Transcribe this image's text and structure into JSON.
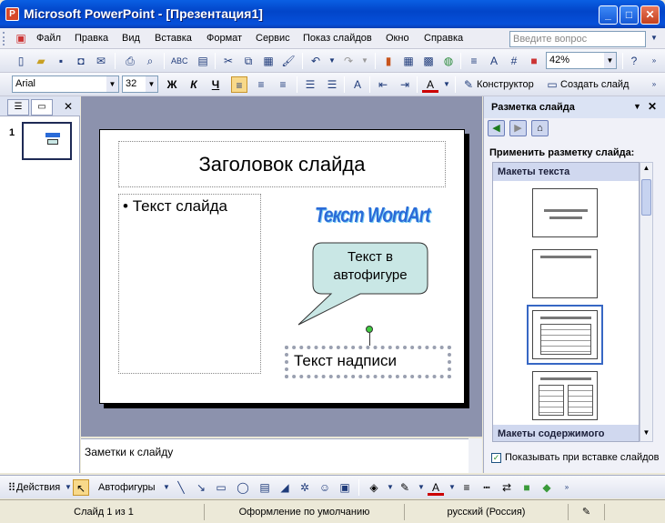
{
  "window": {
    "title": "Microsoft PowerPoint - [Презентация1]"
  },
  "menubar": {
    "items": [
      "Файл",
      "Правка",
      "Вид",
      "Вставка",
      "Формат",
      "Сервис",
      "Показ слайдов",
      "Окно",
      "Справка"
    ],
    "help_placeholder": "Введите вопрос"
  },
  "toolbar_standard": {
    "zoom": "42%"
  },
  "toolbar_format": {
    "font_name": "Arial",
    "font_size": "32",
    "bold": "Ж",
    "italic": "К",
    "underline": "Ч",
    "designer_label": "Конструктор",
    "new_slide_label": "Создать слайд"
  },
  "left_panel": {
    "slide_number": "1"
  },
  "slide": {
    "title": "Заголовок слайда",
    "bullet_text": "Текст слайда",
    "wordart_text": "Текст WordArt",
    "callout_text": "Текст в автофигуре",
    "textbox_text": "Текст надписи"
  },
  "notes": {
    "placeholder": "Заметки к слайду"
  },
  "task_pane": {
    "title": "Разметка слайда",
    "apply_label": "Применить разметку слайда:",
    "section_text": "Макеты текста",
    "section_content": "Макеты содержимого",
    "show_on_insert": "Показывать при вставке слайдов"
  },
  "drawing_toolbar": {
    "actions_label": "Действия",
    "autoshapes_label": "Автофигуры"
  },
  "statusbar": {
    "slide_info": "Слайд 1 из 1",
    "design": "Оформление по умолчанию",
    "language": "русский (Россия)"
  },
  "colors": {
    "titlebar": "#0a5fe3",
    "accent": "#3767c4",
    "callout_fill": "#c9e7e5",
    "wordart": "#2a6bd8"
  }
}
